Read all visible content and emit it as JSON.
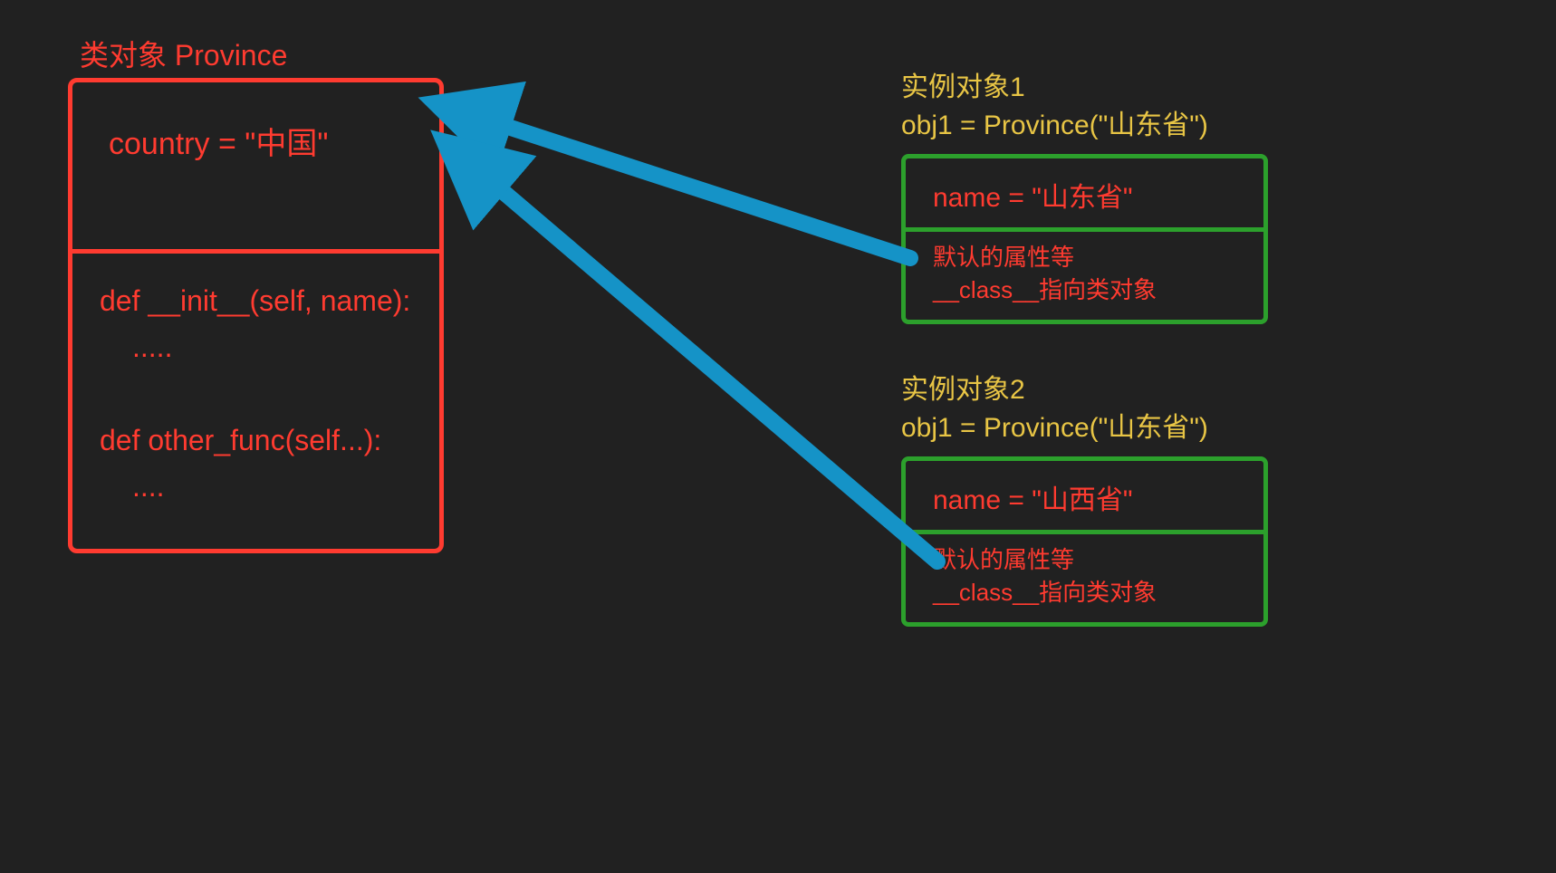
{
  "classObject": {
    "title": "类对象 Province",
    "classAttribute": "country = \"中国\"",
    "method1": "def __init__(self, name):",
    "method1Body": ".....",
    "method2": "def other_func(self...):",
    "method2Body": "...."
  },
  "instance1": {
    "labelLine1": "实例对象1",
    "labelLine2": "obj1 = Province(\"山东省\")",
    "instanceAttribute": "name = \"山东省\"",
    "defaultAttrLine1": "默认的属性等",
    "defaultAttrLine2": "__class__指向类对象"
  },
  "instance2": {
    "labelLine1": "实例对象2",
    "labelLine2": "obj1 = Province(\"山东省\")",
    "instanceAttribute": "name = \"山西省\"",
    "defaultAttrLine1": "默认的属性等",
    "defaultAttrLine2": "__class__指向类对象"
  },
  "colors": {
    "background": "#212121",
    "red": "#ff3b30",
    "green": "#2ca02c",
    "yellow": "#e8c545",
    "blue": "#1593c7"
  }
}
